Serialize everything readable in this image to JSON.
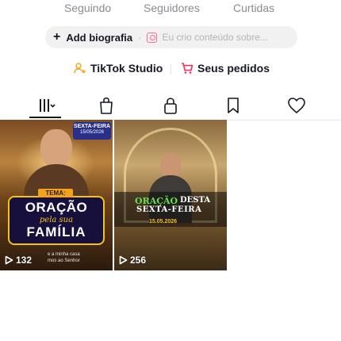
{
  "stats": {
    "following_label": "Seguindo",
    "followers_label": "Seguidores",
    "likes_label": "Curtidas"
  },
  "bio": {
    "add_label": "Add biografia",
    "plus": "+",
    "separator": "·",
    "placeholder": "Eu crio conteúdo sobre..."
  },
  "tools": {
    "studio_label": "TikTok Studio",
    "orders_label": "Seus pedidos"
  },
  "colors": {
    "accent_pink": "#fe2c55",
    "studio_orange": "#f6a623",
    "tab_active": "#161823"
  },
  "tabs": [
    {
      "icon": "videos-grid-icon",
      "active": true
    },
    {
      "icon": "shop-bag-icon",
      "active": false
    },
    {
      "icon": "private-lock-icon",
      "active": false
    },
    {
      "icon": "bookmark-icon",
      "active": false
    },
    {
      "icon": "heart-icon",
      "active": false
    }
  ],
  "videos": [
    {
      "views": "132",
      "overlay": {
        "date_top": "SEXTA-FEIRA",
        "date": "15/05/2026",
        "tag": "TEMA:",
        "title_line1": "ORAÇÃO",
        "title_line2": "pela sua",
        "title_line3": "FAMÍLIA",
        "caption_line1": "e a minha casa",
        "caption_line2": "mos ao Senhor"
      }
    },
    {
      "views": "256",
      "overlay": {
        "title_word1": "ORAÇÃO",
        "title_word2": "DESTA",
        "title_line2": "SEXTA-FEIRA",
        "date": "15.05.2026"
      }
    }
  ]
}
